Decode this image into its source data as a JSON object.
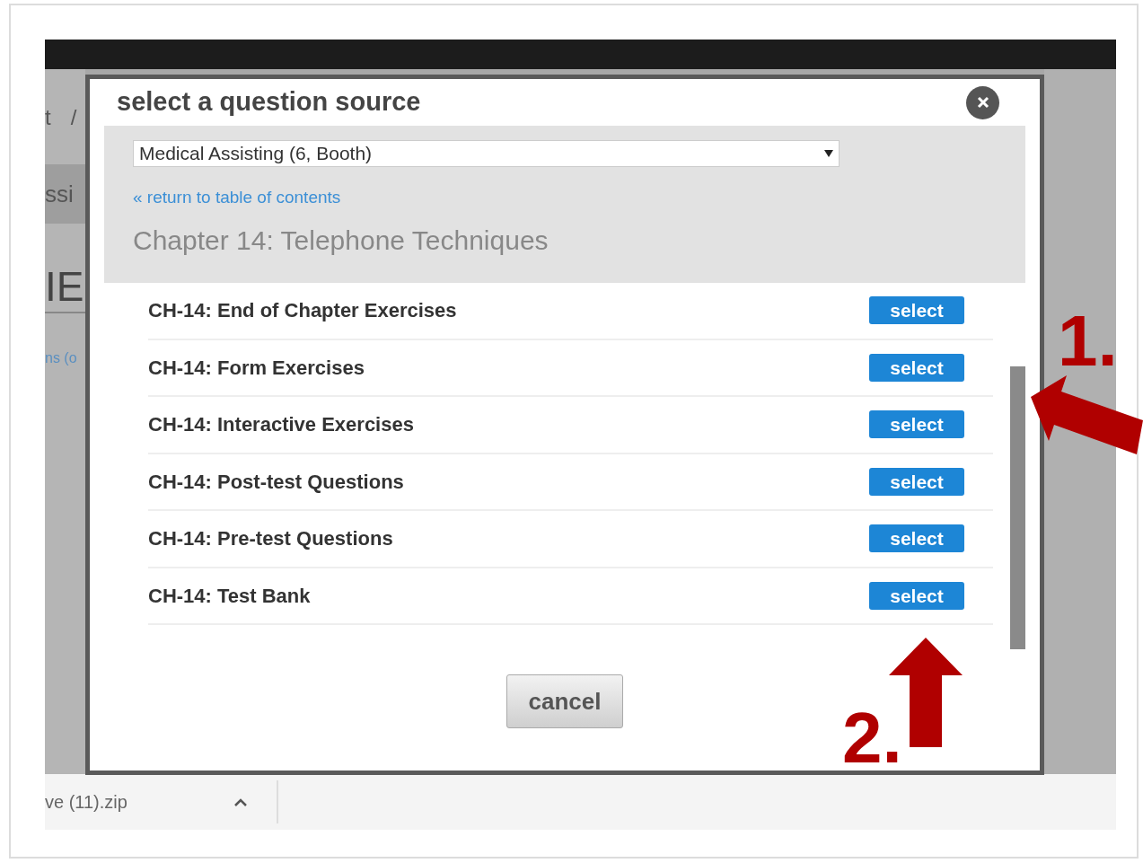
{
  "background_fragments": [
    "t",
    "/",
    "ssi",
    "IE",
    "ns (o"
  ],
  "dialog": {
    "title": "select a question source",
    "source_select": {
      "value": "Medical Assisting (6, Booth)"
    },
    "back_link": "« return to table of contents",
    "chapter": "Chapter 14: Telephone Techniques",
    "items": [
      {
        "label": "CH-14: End of Chapter Exercises",
        "button": "select"
      },
      {
        "label": "CH-14: Form Exercises",
        "button": "select"
      },
      {
        "label": "CH-14: Interactive Exercises",
        "button": "select"
      },
      {
        "label": "CH-14: Post-test Questions",
        "button": "select"
      },
      {
        "label": "CH-14: Pre-test Questions",
        "button": "select"
      },
      {
        "label": "CH-14: Test Bank",
        "button": "select"
      }
    ],
    "cancel": "cancel"
  },
  "download_bar": {
    "file": "ve (11).zip"
  },
  "annotations": [
    {
      "label": "1."
    },
    {
      "label": "2."
    }
  ]
}
